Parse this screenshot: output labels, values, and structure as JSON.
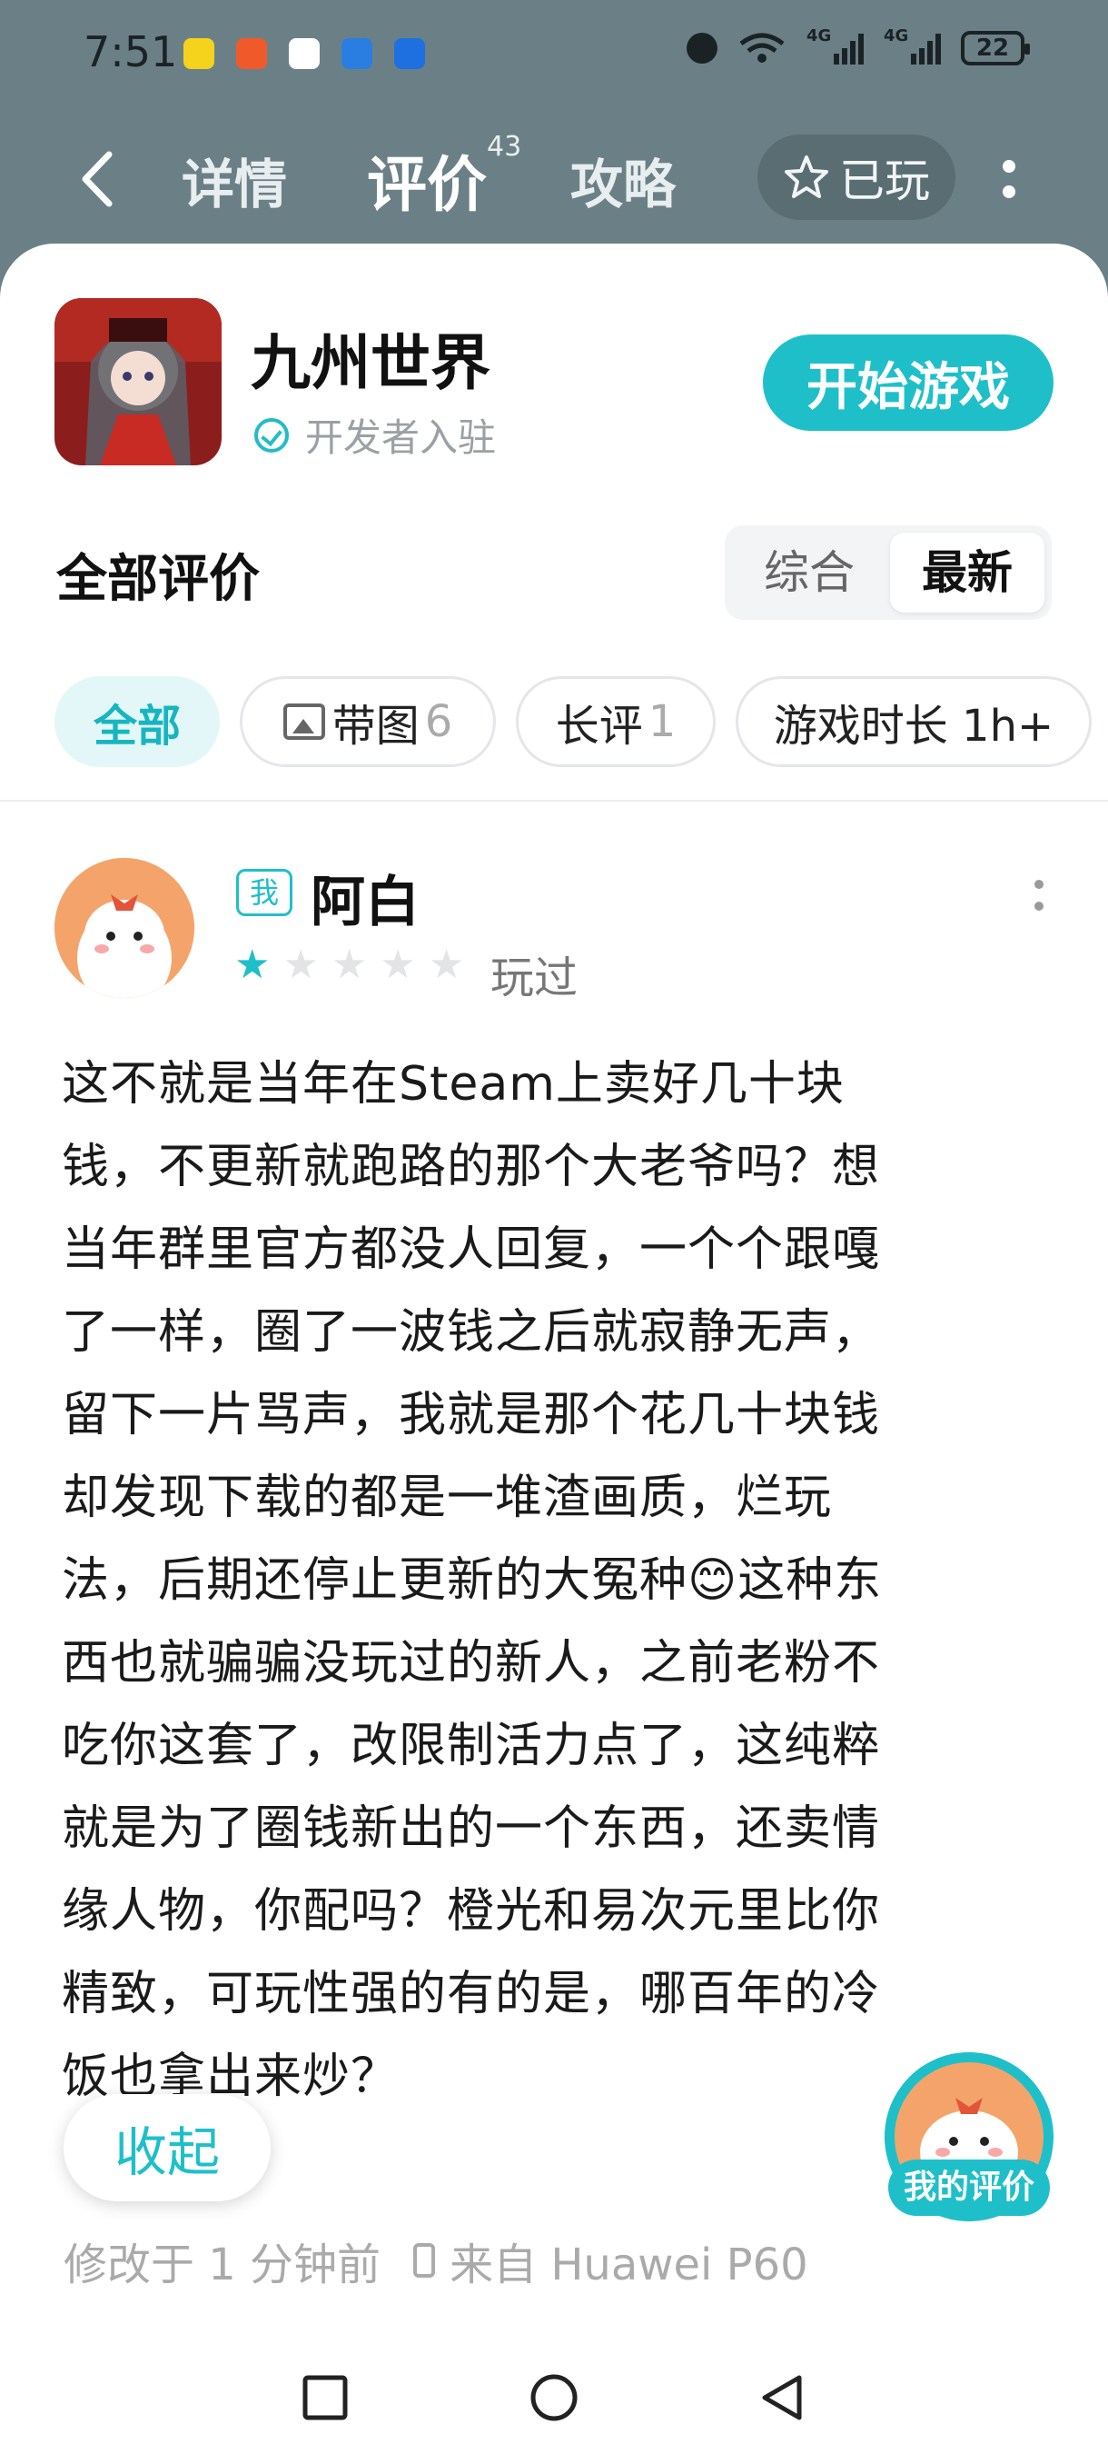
{
  "status_bar": {
    "time": "7:51",
    "battery": "22",
    "net_label": "4G"
  },
  "nav": {
    "tabs": [
      {
        "label": "详情"
      },
      {
        "label": "评价",
        "badge": "43"
      },
      {
        "label": "攻略"
      }
    ],
    "played_label": "已玩"
  },
  "game": {
    "title": "九州世界",
    "developer_badge": "开发者入驻",
    "start_label": "开始游戏"
  },
  "reviews_header": {
    "title": "全部评价",
    "sort_options": [
      "综合",
      "最新"
    ]
  },
  "filters": [
    {
      "label": "全部"
    },
    {
      "label": "带图",
      "count": "6"
    },
    {
      "label": "长评",
      "count": "1"
    },
    {
      "label": "游戏时长 1h+"
    }
  ],
  "review": {
    "me_tag": "我",
    "username": "阿白",
    "rating": 1,
    "rating_max": 5,
    "status": "玩过",
    "text": "这不就是当年在Steam上卖好几十块\n钱，不更新就跑路的那个大老爷吗？想\n当年群里官方都没人回复，一个个跟嘎\n了一样，圈了一波钱之后就寂静无声，\n留下一片骂声，我就是那个花几十块钱\n却发现下载的都是一堆渣画质，烂玩\n法，后期还停止更新的大冤种😊这种东\n西也就骗骗没玩过的新人，之前老粉不\n吃你这套了，改限制活力点了，这纯粹\n就是为了圈钱新出的一个东西，还卖情\n缘人物，你配吗？橙光和易次元里比你\n精致，可玩性强的有的是，哪百年的冷\n饭也拿出来炒？",
    "collapse_label": "收起",
    "modified": "修改于 1 分钟前",
    "device": "来自 Huawei P60"
  },
  "fab": {
    "label": "我的评价"
  },
  "colors": {
    "accent": "#1fbfc9",
    "header_bg": "#6b8086"
  }
}
